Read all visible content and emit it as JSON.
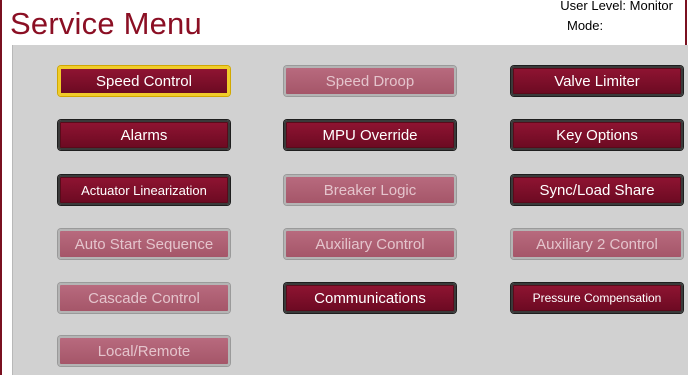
{
  "header": {
    "title": "Service Menu",
    "user_level": "User Level: Monitor",
    "mode": "Mode:"
  },
  "buttons": {
    "speed_control": "Speed Control",
    "speed_droop": "Speed Droop",
    "valve_limiter": "Valve Limiter",
    "alarms": "Alarms",
    "mpu_override": "MPU Override",
    "key_options": "Key Options",
    "actuator_linearization": "Actuator Linearization",
    "breaker_logic": "Breaker Logic",
    "sync_load_share": "Sync/Load Share",
    "auto_start_sequence": "Auto Start Sequence",
    "auxiliary_control": "Auxiliary Control",
    "auxiliary_2_control": "Auxiliary 2 Control",
    "cascade_control": "Cascade Control",
    "communications": "Communications",
    "pressure_compensation": "Pressure Compensation",
    "local_remote": "Local/Remote"
  },
  "colors": {
    "brand": "#8b0f24",
    "button_active": "#7d0f2a",
    "button_disabled": "#b05f73",
    "selected_outline": "#f0cc2a",
    "panel": "#d1d1d1"
  }
}
